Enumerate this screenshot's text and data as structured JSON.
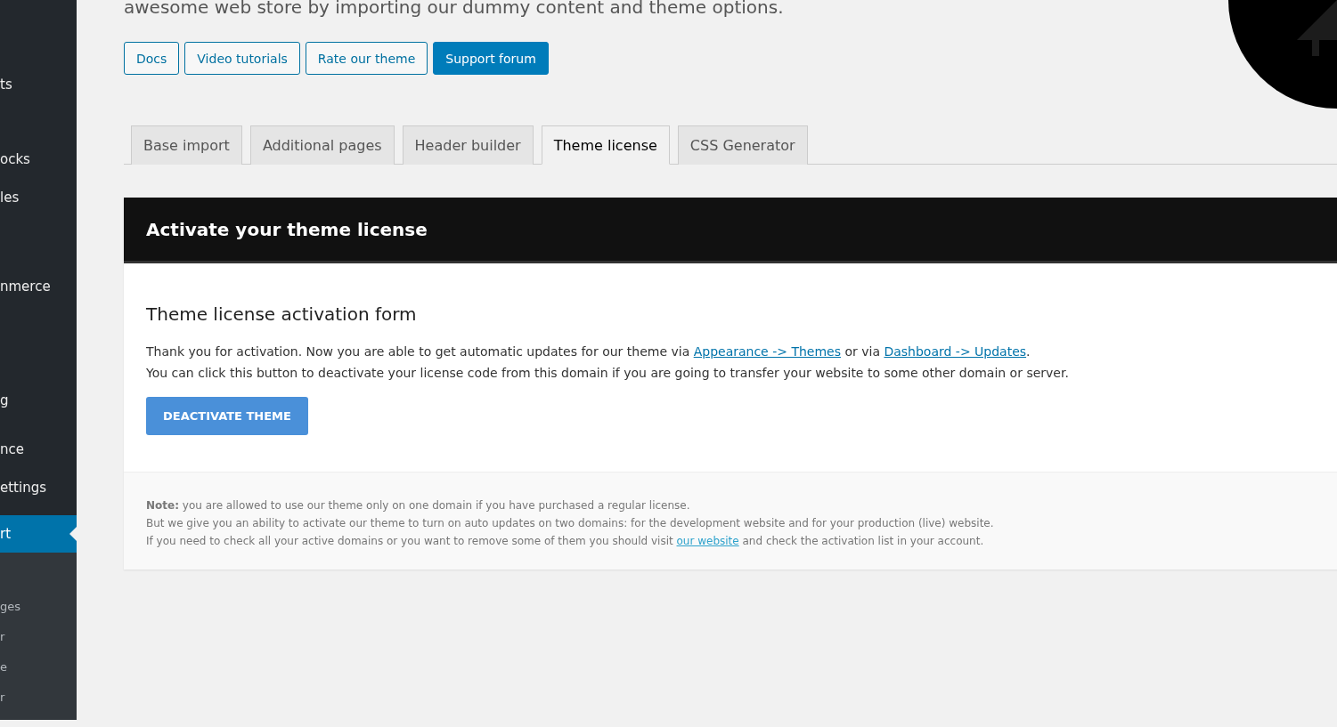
{
  "sidebar": {
    "items": [
      {
        "label": "ts",
        "selected": false
      },
      {
        "label": "ocks",
        "selected": false
      },
      {
        "label": "les",
        "selected": false
      },
      {
        "label": "nmerce",
        "selected": false
      },
      {
        "label": "g",
        "selected": false
      },
      {
        "label": "nce",
        "selected": false
      },
      {
        "label": "ettings",
        "selected": false
      },
      {
        "label": "rt",
        "selected": true
      }
    ],
    "submenu": [
      "ges",
      "r",
      "e",
      "r"
    ]
  },
  "intro": "awesome web store by importing our dummy content and theme options.",
  "buttons": [
    {
      "label": "Docs",
      "kind": "outline"
    },
    {
      "label": "Video tutorials",
      "kind": "outline"
    },
    {
      "label": "Rate our theme",
      "kind": "outline"
    },
    {
      "label": "Support forum",
      "kind": "primary"
    }
  ],
  "tabs": [
    {
      "label": "Base import",
      "selected": false
    },
    {
      "label": "Additional pages",
      "selected": false
    },
    {
      "label": "Header builder",
      "selected": false
    },
    {
      "label": "Theme license",
      "selected": true
    },
    {
      "label": "CSS Generator",
      "selected": false
    }
  ],
  "panel": {
    "title": "Activate your theme license",
    "form_title": "Theme license activation form",
    "text_before": "Thank you for activation. Now you are able to get automatic updates for our theme via",
    "link1": "Appearance -> Themes",
    "text_mid": "or via",
    "link2": "Dashboard -> Updates",
    "text_end": ".",
    "text2": "You can click this button to deactivate your license code from this domain if you are going to transfer your website to some other domain or server.",
    "button": "DEACTIVATE THEME",
    "note1": "**Note:** you are allowed to use our theme only on one domain if you have purchased a regular license.",
    "note2": "But we give you an ability to activate our theme to turn on auto updates on two domains: for the development website and for your production (live) website.",
    "note3_before": "If you need to check all your active domains or you want to remove some of them you should visit",
    "note3_link": "our website",
    "note3_after": "and check the activation list in your account."
  }
}
